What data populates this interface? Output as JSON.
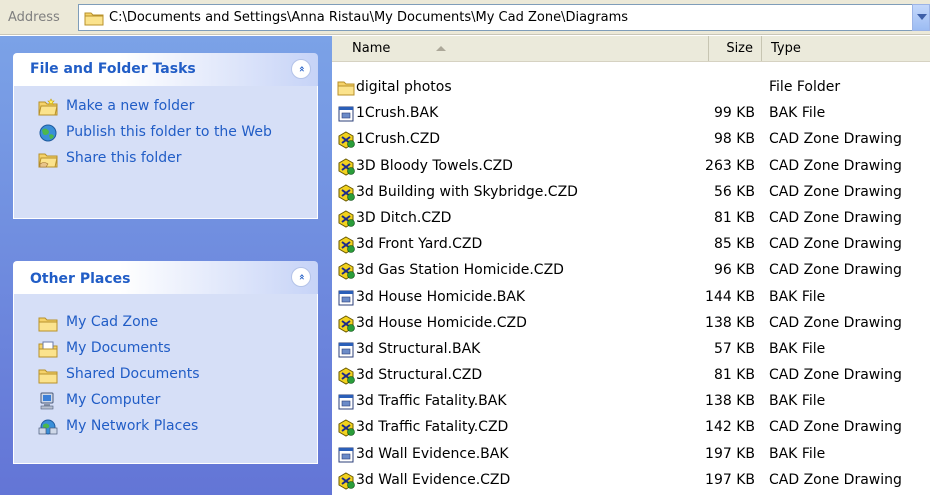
{
  "address": {
    "label": "Address",
    "path": "C:\\Documents and Settings\\Anna Ristau\\My Documents\\My Cad Zone\\Diagrams"
  },
  "task_pane": {
    "file_folder_tasks": {
      "title": "File and Folder Tasks",
      "collapse_glyph": "«",
      "items": [
        {
          "label": "Make a new folder",
          "icon": "new-folder-icon"
        },
        {
          "label": "Publish this folder to the Web",
          "icon": "publish-web-icon"
        },
        {
          "label": "Share this folder",
          "icon": "share-folder-icon"
        }
      ]
    },
    "other_places": {
      "title": "Other Places",
      "collapse_glyph": "«",
      "items": [
        {
          "label": "My Cad Zone",
          "icon": "folder-icon"
        },
        {
          "label": "My Documents",
          "icon": "my-documents-icon"
        },
        {
          "label": "Shared Documents",
          "icon": "folder-icon"
        },
        {
          "label": "My Computer",
          "icon": "my-computer-icon"
        },
        {
          "label": "My Network Places",
          "icon": "network-places-icon"
        }
      ]
    }
  },
  "file_list": {
    "columns": {
      "name": "Name",
      "size": "Size",
      "type": "Type"
    },
    "rows": [
      {
        "name": "digital photos",
        "size": "",
        "type": "File Folder",
        "icon": "folder"
      },
      {
        "name": "1Crush.BAK",
        "size": "99 KB",
        "type": "BAK File",
        "icon": "bak"
      },
      {
        "name": "1Crush.CZD",
        "size": "98 KB",
        "type": "CAD Zone Drawing",
        "icon": "czd"
      },
      {
        "name": "3D Bloody Towels.CZD",
        "size": "263 KB",
        "type": "CAD Zone Drawing",
        "icon": "czd"
      },
      {
        "name": "3d Building with Skybridge.CZD",
        "size": "56 KB",
        "type": "CAD Zone Drawing",
        "icon": "czd"
      },
      {
        "name": "3D Ditch.CZD",
        "size": "81 KB",
        "type": "CAD Zone Drawing",
        "icon": "czd"
      },
      {
        "name": "3d Front Yard.CZD",
        "size": "85 KB",
        "type": "CAD Zone Drawing",
        "icon": "czd"
      },
      {
        "name": "3d Gas Station Homicide.CZD",
        "size": "96 KB",
        "type": "CAD Zone Drawing",
        "icon": "czd"
      },
      {
        "name": "3d House Homicide.BAK",
        "size": "144 KB",
        "type": "BAK File",
        "icon": "bak"
      },
      {
        "name": "3d House Homicide.CZD",
        "size": "138 KB",
        "type": "CAD Zone Drawing",
        "icon": "czd"
      },
      {
        "name": "3d Structural.BAK",
        "size": "57 KB",
        "type": "BAK File",
        "icon": "bak"
      },
      {
        "name": "3d Structural.CZD",
        "size": "81 KB",
        "type": "CAD Zone Drawing",
        "icon": "czd"
      },
      {
        "name": "3d Traffic Fatality.BAK",
        "size": "138 KB",
        "type": "BAK File",
        "icon": "bak"
      },
      {
        "name": "3d Traffic Fatality.CZD",
        "size": "142 KB",
        "type": "CAD Zone Drawing",
        "icon": "czd"
      },
      {
        "name": "3d Wall Evidence.BAK",
        "size": "197 KB",
        "type": "BAK File",
        "icon": "bak"
      },
      {
        "name": "3d Wall Evidence.CZD",
        "size": "197 KB",
        "type": "CAD Zone Drawing",
        "icon": "czd"
      }
    ]
  },
  "colors": {
    "task_link": "#215dc6",
    "pane_gradient_top": "#7ba2e7",
    "pane_gradient_bottom": "#6375d6",
    "panel_body": "#d6dff7"
  }
}
